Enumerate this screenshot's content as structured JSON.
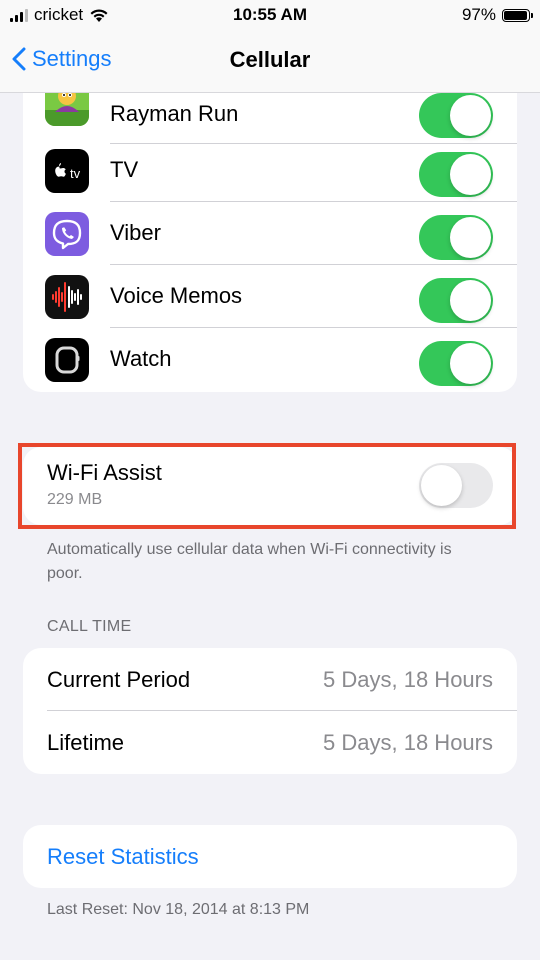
{
  "status": {
    "carrier": "cricket",
    "time": "10:55 AM",
    "battery": "97%",
    "battery_level": 0.97
  },
  "nav": {
    "back_label": "Settings",
    "title": "Cellular"
  },
  "apps": [
    {
      "name": "Rayman Run",
      "enabled": true,
      "icon": "rayman-run-icon"
    },
    {
      "name": "TV",
      "enabled": true,
      "icon": "apple-tv-icon"
    },
    {
      "name": "Viber",
      "enabled": true,
      "icon": "viber-icon"
    },
    {
      "name": "Voice Memos",
      "enabled": true,
      "icon": "voice-memos-icon"
    },
    {
      "name": "Watch",
      "enabled": true,
      "icon": "watch-icon"
    }
  ],
  "wifi_assist": {
    "label": "Wi-Fi Assist",
    "usage": "229 MB",
    "enabled": false,
    "description": "Automatically use cellular data when Wi-Fi connectivity is poor."
  },
  "call_time": {
    "header": "CALL TIME",
    "rows": [
      {
        "label": "Current Period",
        "value": "5 Days, 18 Hours"
      },
      {
        "label": "Lifetime",
        "value": "5 Days, 18 Hours"
      }
    ]
  },
  "reset": {
    "label": "Reset Statistics",
    "last_reset": "Last Reset: Nov 18, 2014 at 8:13 PM"
  },
  "colors": {
    "toggle_on": "#34c759",
    "toggle_off": "#e9e9eb",
    "link": "#157efb",
    "highlight": "#e8462c"
  }
}
